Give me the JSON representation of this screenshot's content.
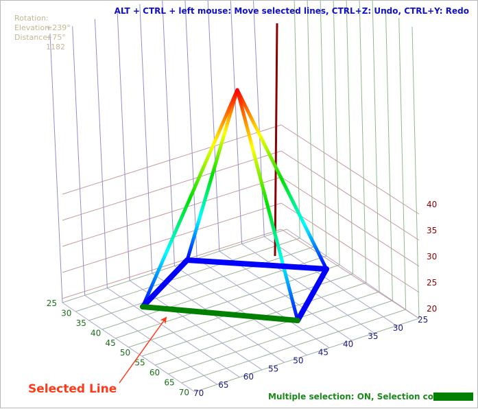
{
  "readouts": {
    "rotation_label": "Rotation:",
    "rotation_value": "+239°",
    "elevation_label": "Elevation:",
    "elevation_value": "+75°",
    "distance_label": "Distance:",
    "distance_value": "1182"
  },
  "hint": "ALT + CTRL + left mouse: Move selected lines, CTRL+Z: Undo, CTRL+Y: Redo",
  "status": {
    "text": "Multiple selection: ON, Selection color:",
    "selection_color": "#008000"
  },
  "callout": "Selected Line",
  "axes": {
    "z_ticks": [
      "20",
      "25",
      "30",
      "35",
      "40"
    ],
    "left_ticks": [
      "25",
      "30",
      "35",
      "40",
      "45",
      "50",
      "55",
      "60",
      "65",
      "70"
    ],
    "bottom_ticks": [
      "70",
      "65",
      "60",
      "55",
      "50",
      "45",
      "40",
      "35",
      "30",
      "25"
    ]
  },
  "colors": {
    "z_tick": "#8b0000",
    "left_tick": "#1a6e1a",
    "bottom_tick": "#1a1a80",
    "selected_line": "#008000",
    "base_edge": "#0000ff",
    "vertical_axis": "#8b0000",
    "callout": "#ff3a1a"
  }
}
